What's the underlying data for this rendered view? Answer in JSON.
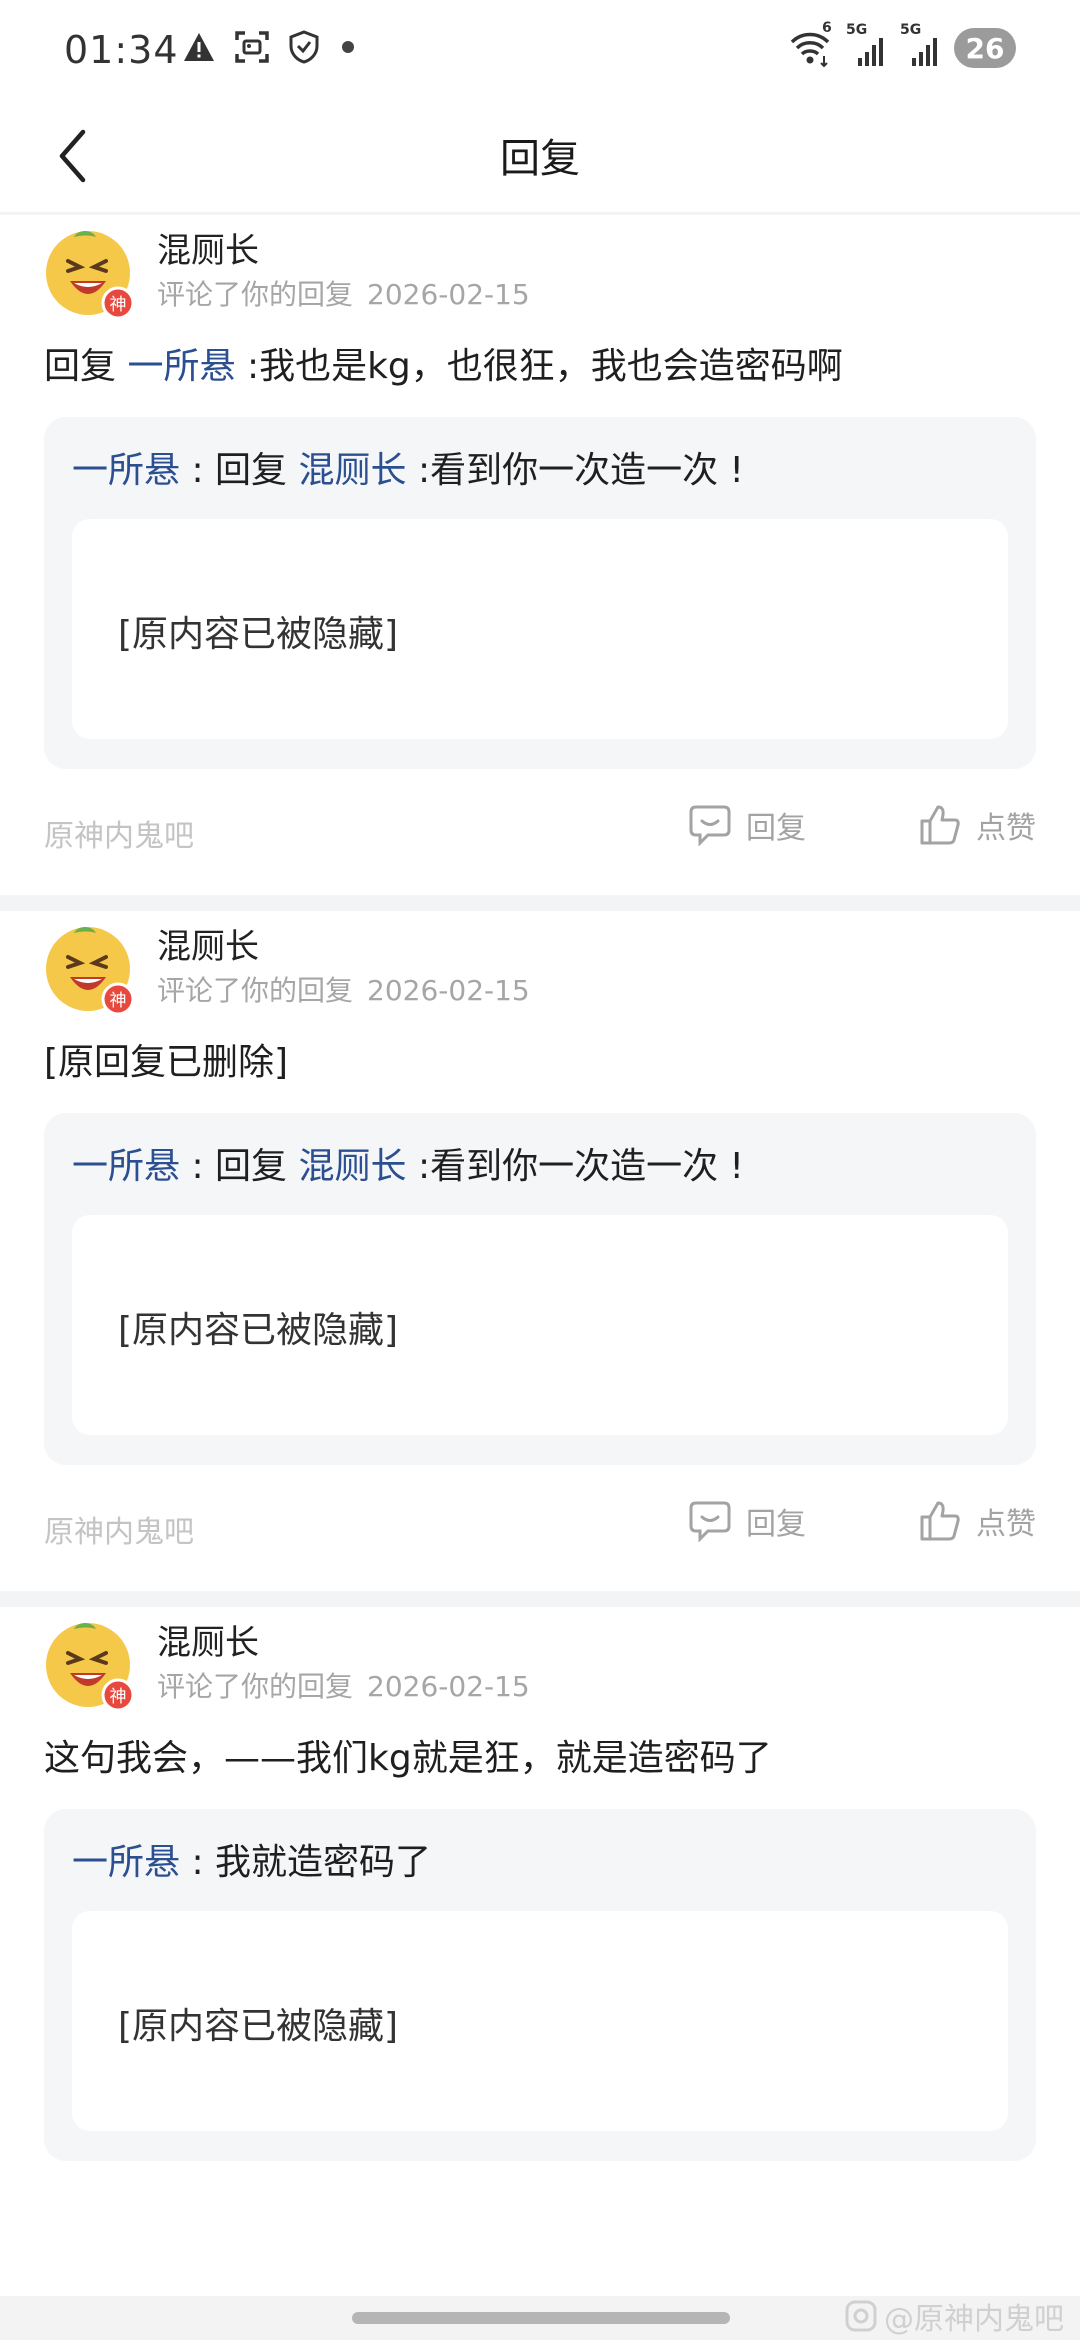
{
  "status_bar": {
    "time": "01:34",
    "signal_1_label": "6",
    "signal_2_label": "5G",
    "signal_3_label": "5G",
    "battery": "26"
  },
  "nav": {
    "title": "回复"
  },
  "cards": [
    {
      "author": "混厕长",
      "avatar_badge": "神",
      "action_text": "评论了你的回复",
      "date": "2026-02-15",
      "comment_prefix": "回复",
      "comment_mention": "一所悬",
      "comment_body": ":我也是kg，也很狂，我也会造密码啊",
      "quote_name": "一所悬",
      "quote_sep": " : ",
      "quote_reply_word": "回复",
      "quote_target": "混厕长",
      "quote_text": ":看到你一次造一次 !",
      "hidden_text": "[原内容已被隐藏]",
      "forum": "原神内鬼吧",
      "reply_label": "回复",
      "like_label": "点赞"
    },
    {
      "author": "混厕长",
      "avatar_badge": "神",
      "action_text": "评论了你的回复",
      "date": "2026-02-15",
      "comment_text": "[原回复已删除]",
      "quote_name": "一所悬",
      "quote_sep": " : ",
      "quote_reply_word": "回复",
      "quote_target": "混厕长",
      "quote_text": ":看到你一次造一次 !",
      "hidden_text": "[原内容已被隐藏]",
      "forum": "原神内鬼吧",
      "reply_label": "回复",
      "like_label": "点赞"
    },
    {
      "author": "混厕长",
      "avatar_badge": "神",
      "action_text": "评论了你的回复",
      "date": "2026-02-15",
      "comment_text": "这句我会，——我们kg就是狂，就是造密码了",
      "quote_name": "一所悬",
      "quote_sep": " : ",
      "quote_text": "我就造密码了",
      "hidden_text": "[原内容已被隐藏]"
    }
  ],
  "watermark": "@原神内鬼吧",
  "colors": {
    "mention": "#2b4f91",
    "muted": "#a6a6a6",
    "quote_bg": "#f5f6f8"
  }
}
